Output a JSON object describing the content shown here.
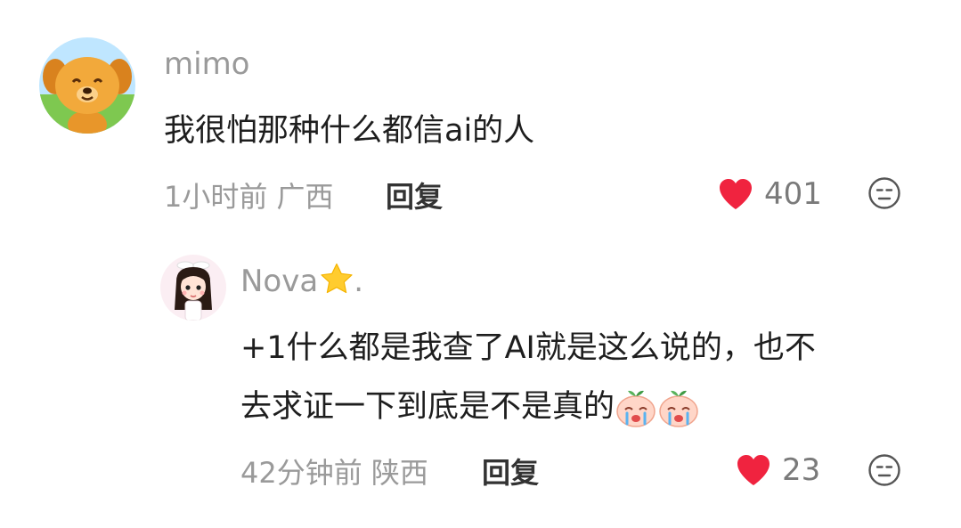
{
  "comments": [
    {
      "username": "mimo",
      "text": "我很怕那种什么都信ai的人",
      "time_location": "1小时前 广西",
      "reply_label": "回复",
      "likes": "401",
      "avatar": "dog-avatar"
    },
    {
      "username": "Nova",
      "username_suffix": ".",
      "username_emoji": "star-emoji",
      "text_line1": "+1什么都是我查了AI就是这么说的，也不",
      "text_line2": "去求证一下到底是不是真的",
      "trailing_emojis": [
        "crying-peach-emoji",
        "crying-peach-emoji"
      ],
      "time_location": "42分钟前 陕西",
      "reply_label": "回复",
      "likes": "23",
      "avatar": "girl-avatar"
    }
  ],
  "colors": {
    "heart": "#f0233f",
    "meta_text": "#9a9a9a",
    "body_text": "#1e1e1e"
  }
}
